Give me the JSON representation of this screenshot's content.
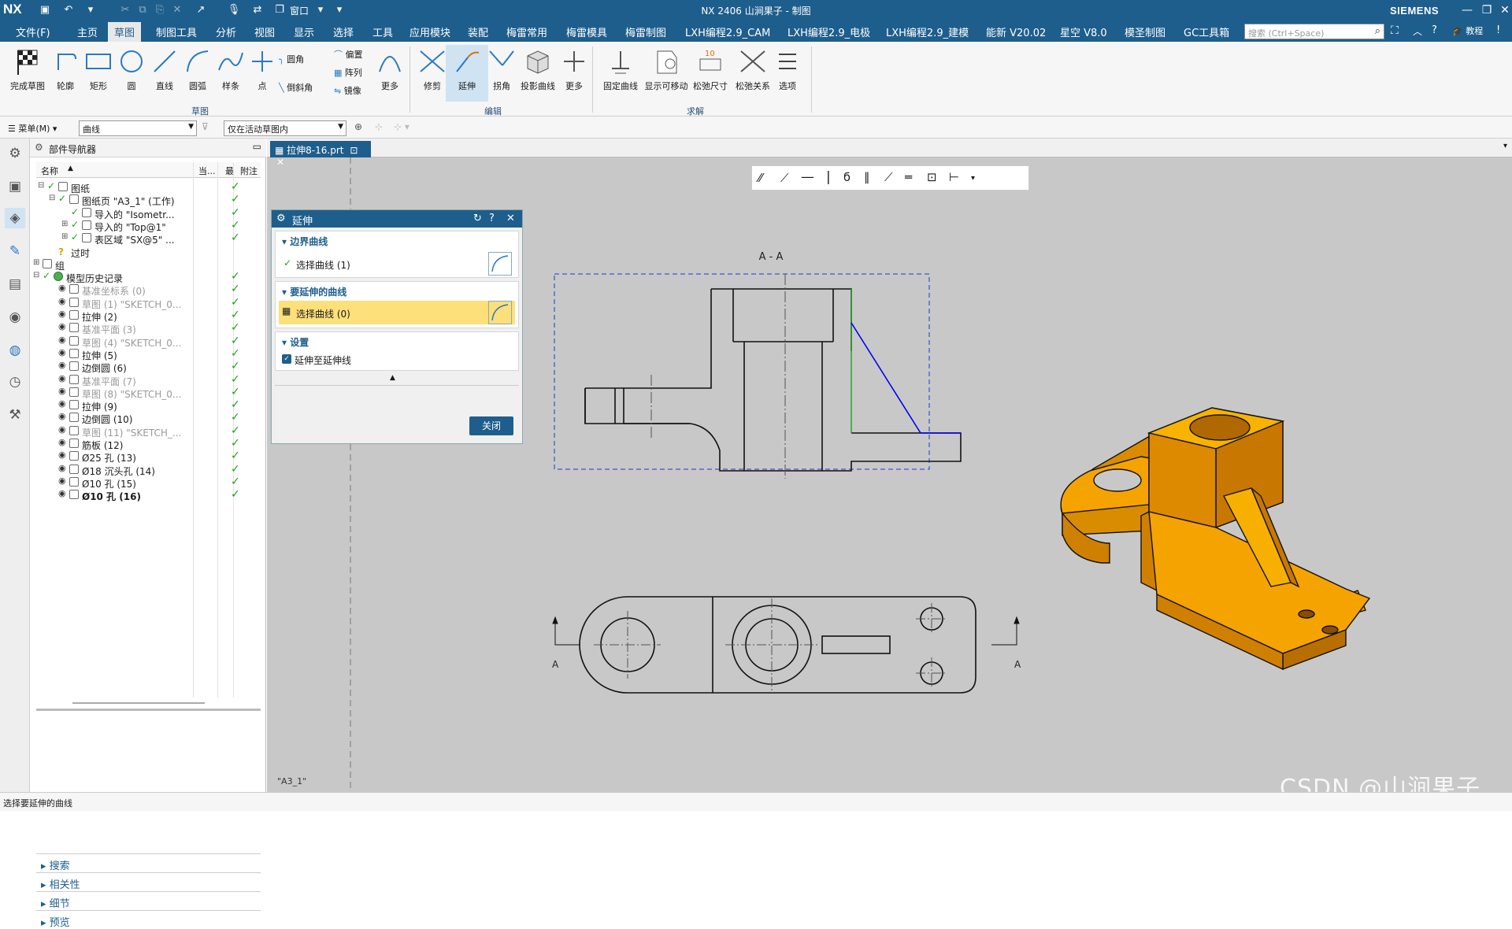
{
  "titlebar": {
    "logo": "NX",
    "window_menu": "窗口",
    "title": "NX 2406 山涧果子 - 制图",
    "brand": "SIEMENS"
  },
  "menubar": {
    "items": [
      "文件(F)",
      "主页",
      "草图",
      "制图工具",
      "分析",
      "视图",
      "显示",
      "选择",
      "工具",
      "应用模块",
      "装配",
      "梅雷常用",
      "梅雷模具",
      "梅雷制图",
      "LXH编程2.9_CAM",
      "LXH编程2.9_电极",
      "LXH编程2.9_建模",
      "能新 V20.02",
      "星空 V8.0",
      "模圣制图",
      "GC工具箱"
    ],
    "active_index": 2,
    "search_placeholder": "搜索 (Ctrl+Space)",
    "tutorial": "教程"
  },
  "ribbon": {
    "sketch_buttons": [
      "完成草图",
      "轮廓",
      "矩形",
      "圆",
      "直线",
      "圆弧",
      "样条",
      "点"
    ],
    "small_tools": [
      "圆角",
      "倒斜角",
      "偏置",
      "阵列",
      "镜像"
    ],
    "more1": "更多",
    "edit_buttons": [
      "修剪",
      "延伸",
      "拐角",
      "投影曲线"
    ],
    "more2": "更多",
    "solve_buttons": [
      "固定曲线",
      "显示可移动",
      "松弛尺寸",
      "松弛关系",
      "选项"
    ],
    "group_labels": [
      "草图",
      "编辑",
      "求解"
    ]
  },
  "subbar": {
    "menu": "菜单(M)",
    "filter": "曲线",
    "scope": "仅在活动草图内"
  },
  "navigator": {
    "title": "部件导航器",
    "columns": [
      "名称",
      "当...",
      "最",
      "附注"
    ],
    "rows": [
      {
        "label": "图纸",
        "style": "normal"
      },
      {
        "label": "图纸页 \"A3_1\" (工作)",
        "style": "normal"
      },
      {
        "label": "导入的 \"Isometr...",
        "style": "normal"
      },
      {
        "label": "导入的 \"Top@1\"",
        "style": "normal"
      },
      {
        "label": "表区域 \"SX@5\" ...",
        "style": "normal"
      },
      {
        "label": "过时",
        "style": "normal"
      },
      {
        "label": "组",
        "style": "normal"
      },
      {
        "label": "模型历史记录",
        "style": "normal"
      },
      {
        "label": "基准坐标系 (0)",
        "style": "dim"
      },
      {
        "label": "草图 (1) \"SKETCH_0...",
        "style": "dim"
      },
      {
        "label": "拉伸 (2)",
        "style": "normal"
      },
      {
        "label": "基准平面 (3)",
        "style": "dim"
      },
      {
        "label": "草图 (4) \"SKETCH_0...",
        "style": "dim"
      },
      {
        "label": "拉伸 (5)",
        "style": "normal"
      },
      {
        "label": "边倒圆 (6)",
        "style": "normal"
      },
      {
        "label": "基准平面 (7)",
        "style": "dim"
      },
      {
        "label": "草图 (8) \"SKETCH_0...",
        "style": "dim"
      },
      {
        "label": "拉伸 (9)",
        "style": "normal"
      },
      {
        "label": "边倒圆 (10)",
        "style": "normal"
      },
      {
        "label": "草图 (11) \"SKETCH_...",
        "style": "dim"
      },
      {
        "label": "筋板 (12)",
        "style": "normal"
      },
      {
        "label": "Ø25 孔 (13)",
        "style": "normal"
      },
      {
        "label": "Ø18 沉头孔 (14)",
        "style": "normal"
      },
      {
        "label": "Ø10 孔 (15)",
        "style": "normal"
      },
      {
        "label": "Ø10 孔 (16)",
        "style": "bold"
      }
    ],
    "panels": [
      "搜索",
      "相关性",
      "细节",
      "预览"
    ]
  },
  "document": {
    "tab": "拉伸8-16.prt",
    "section_label": "A - A",
    "cut_label_left": "A",
    "cut_label_right": "A",
    "sheet": "\"A3_1\""
  },
  "extend_dialog": {
    "title": "延伸",
    "section1": "边界曲线",
    "row1": "选择曲线 (1)",
    "section2": "要延伸的曲线",
    "row2": "选择曲线 (0)",
    "section3": "设置",
    "checkbox": "延伸至延伸线",
    "close": "关闭"
  },
  "status": {
    "prompt": "选择要延伸的曲线"
  },
  "watermark": "CSDN @山涧果子",
  "colors": {
    "accent": "#1e5e8c",
    "highlight": "#fde07a",
    "model": "#f5a000",
    "curve_blue": "#0000ee",
    "curve_green": "#2aa02a"
  }
}
